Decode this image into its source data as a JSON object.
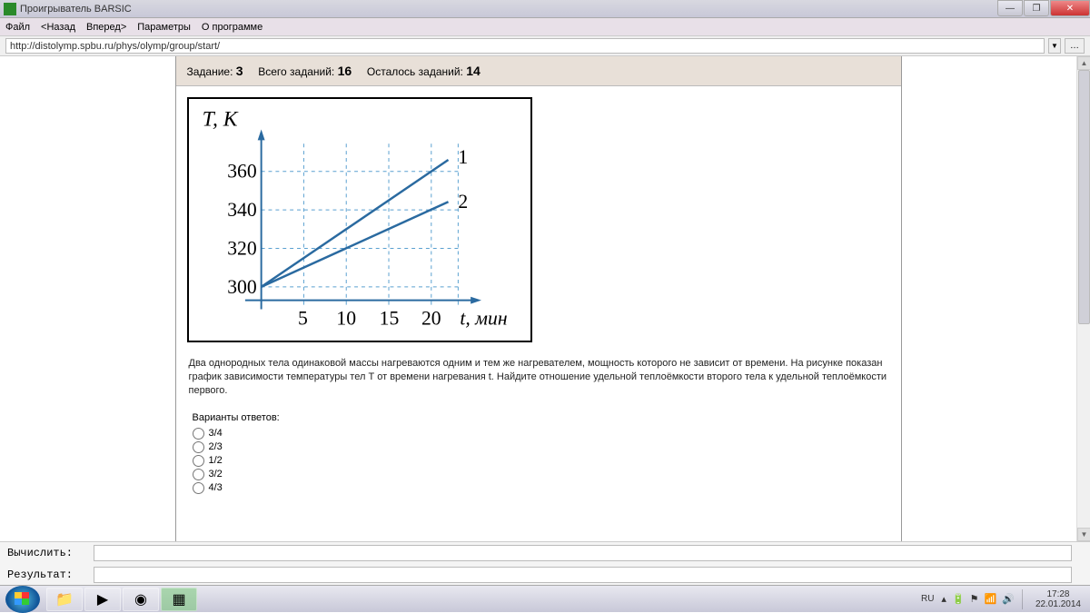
{
  "window": {
    "title": "Проигрыватель BARSIC"
  },
  "menu": {
    "file": "Файл",
    "back": "<Назад",
    "forward": "Вперед>",
    "params": "Параметры",
    "about": "О программе"
  },
  "url": "http://distolymp.spbu.ru/phys/olymp/group/start/",
  "task": {
    "current_label": "Задание:",
    "current": "3",
    "total_label": "Всего заданий:",
    "total": "16",
    "remaining_label": "Осталось заданий:",
    "remaining": "14"
  },
  "chart_data": {
    "type": "line",
    "xlabel": "t, мин",
    "ylabel": "T, К",
    "x_ticks": [
      5,
      10,
      15,
      20
    ],
    "y_ticks": [
      300,
      320,
      340,
      360
    ],
    "xlim": [
      0,
      22
    ],
    "ylim": [
      295,
      370
    ],
    "series": [
      {
        "name": "1",
        "points": [
          [
            0,
            300
          ],
          [
            22,
            366
          ]
        ]
      },
      {
        "name": "2",
        "points": [
          [
            0,
            300
          ],
          [
            22,
            344
          ]
        ]
      }
    ]
  },
  "problem_text": "Два однородных тела одинаковой массы нагреваются одним и тем же нагревателем, мощность которого не зависит от времени. На рисунке показан график зависимости температуры тел Т от времени нагревания t. Найдите отношение удельной теплоёмкости второго тела к удельной теплоёмкости первого.",
  "answers": {
    "title": "Варианты ответов:",
    "options": [
      "3/4",
      "2/3",
      "1/2",
      "3/2",
      "4/3"
    ]
  },
  "compute": {
    "calc_label": "Вычислить:",
    "result_label": "Результат:"
  },
  "tray": {
    "lang": "RU",
    "time": "17:28",
    "date": "22.01.2014"
  }
}
